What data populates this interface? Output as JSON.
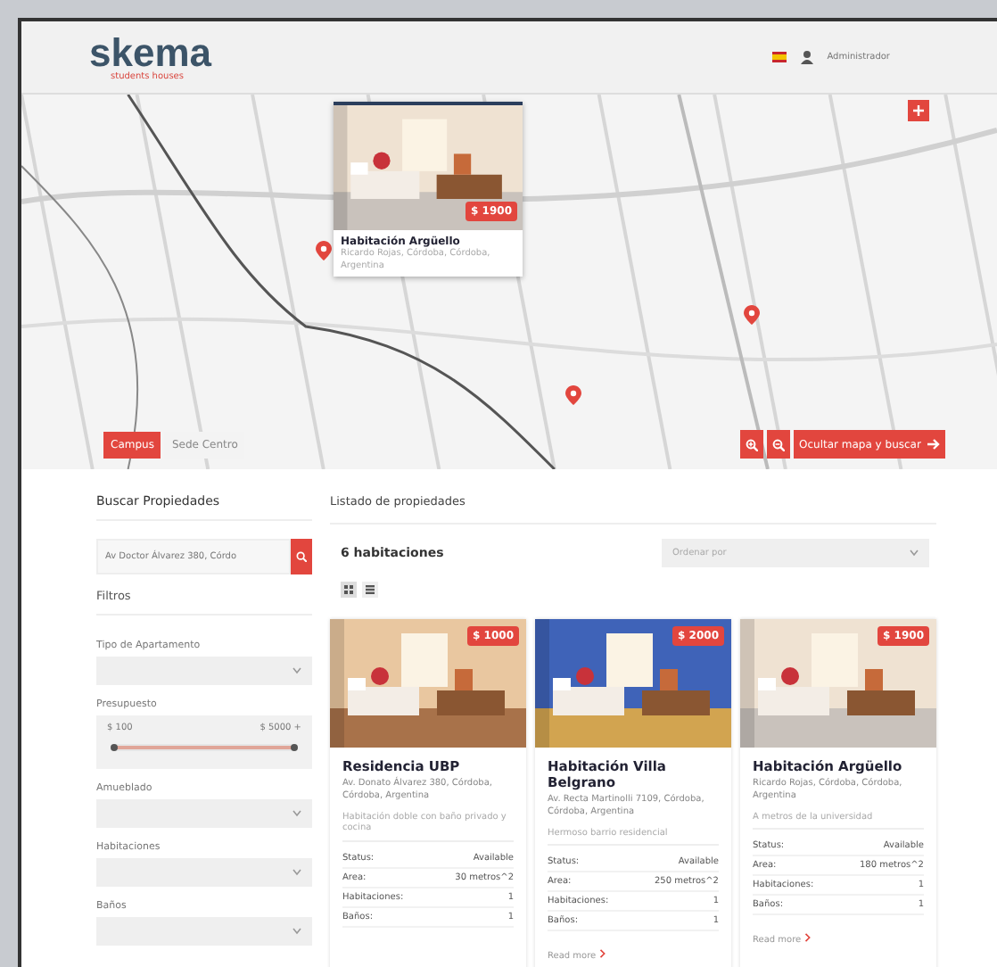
{
  "header": {
    "logo": "skema",
    "tagline": "students houses",
    "user": "Administrador"
  },
  "map": {
    "popup": {
      "price": "$ 1900",
      "title": "Habitación Argüello",
      "address": "Ricardo Rojas, Córdoba, Córdoba, Argentina"
    },
    "locations": [
      {
        "label": "Campus",
        "selected": true
      },
      {
        "label": "Sede Centro",
        "selected": false
      }
    ],
    "toggle_button": "Ocultar mapa y buscar"
  },
  "sidebar": {
    "title": "Buscar Propiedades",
    "search": {
      "value": "Av Doctor Álvarez 380, Córdo"
    },
    "filters_title": "Filtros",
    "filters": [
      {
        "kind": "select",
        "label": "Tipo de Apartamento"
      },
      {
        "kind": "range",
        "label": "Presupuesto",
        "min": "$ 100",
        "max": "$ 5000 +",
        "level": 1
      },
      {
        "kind": "select",
        "label": "Amueblado"
      },
      {
        "kind": "select",
        "label": "Habitaciones"
      },
      {
        "kind": "select",
        "label": "Baños"
      }
    ]
  },
  "listing": {
    "title": "Listado de propiedades",
    "count": "6 habitaciones",
    "sort": {
      "placeholder": "Ordenar por"
    },
    "views": [
      {
        "kind": "grid",
        "selected": true
      },
      {
        "kind": "list",
        "selected": false
      }
    ],
    "cards": [
      {
        "price": "$ 1000",
        "title": "Residencia UBP",
        "address": "Av. Donato Álvarez 380, Córdoba, Córdoba, Argentina",
        "description": "Habitación doble con baño privado y cocina",
        "specs": [
          {
            "label": "Status:",
            "value": "Available"
          },
          {
            "label": "Area:",
            "value": "30 metros^2"
          },
          {
            "label": "Habitaciones:",
            "value": "1"
          },
          {
            "label": "Baños:",
            "value": "1"
          }
        ]
      },
      {
        "price": "$ 2000",
        "title": "Habitación Villa Belgrano",
        "address": "Av. Recta Martinolli 7109, Córdoba, Córdoba, Argentina",
        "description": "Hermoso barrio residencial",
        "specs": [
          {
            "label": "Status:",
            "value": "Available"
          },
          {
            "label": "Area:",
            "value": "250 metros^2"
          },
          {
            "label": "Habitaciones:",
            "value": "1"
          },
          {
            "label": "Baños:",
            "value": "1"
          }
        ],
        "link": "Read more"
      },
      {
        "price": "$ 1900",
        "title": "Habitación Argüello",
        "address": "Ricardo Rojas, Córdoba, Córdoba, Argentina",
        "description": "A metros de la universidad",
        "specs": [
          {
            "label": "Status:",
            "value": "Available"
          },
          {
            "label": "Area:",
            "value": "180 metros^2"
          },
          {
            "label": "Habitaciones:",
            "value": "1"
          },
          {
            "label": "Baños:",
            "value": "1"
          }
        ],
        "link": "Read more"
      }
    ]
  }
}
